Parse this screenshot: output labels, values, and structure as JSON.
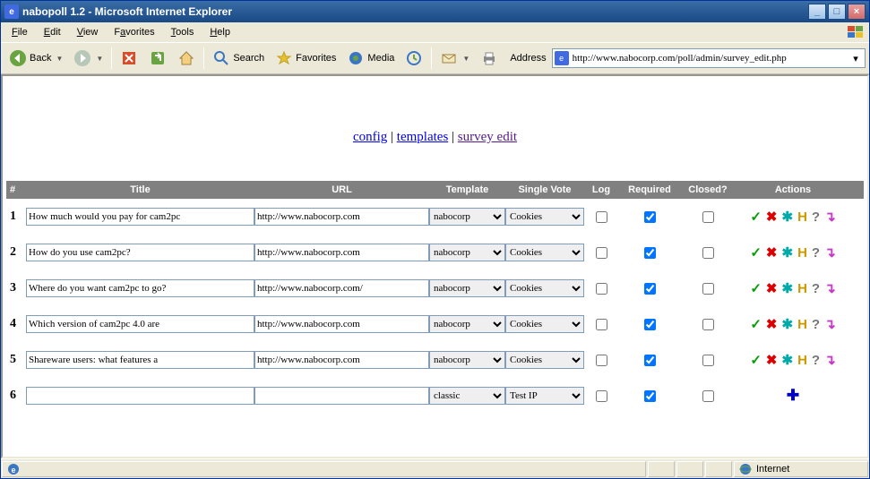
{
  "window": {
    "title": "nabopoll 1.2 - Microsoft Internet Explorer"
  },
  "menus": {
    "file": "File",
    "edit": "Edit",
    "view": "View",
    "favorites": "Favorites",
    "tools": "Tools",
    "help": "Help"
  },
  "toolbar": {
    "back": "Back",
    "search": "Search",
    "favorites": "Favorites",
    "media": "Media"
  },
  "address": {
    "label": "Address",
    "url": "http://www.nabocorp.com/poll/admin/survey_edit.php"
  },
  "nav": {
    "config": "config",
    "templates": "templates",
    "survey_edit": "survey edit",
    "sep": " | "
  },
  "headers": {
    "num": "#",
    "title": "Title",
    "url": "URL",
    "template": "Template",
    "single_vote": "Single Vote",
    "log": "Log",
    "required": "Required",
    "closed": "Closed?",
    "actions": "Actions"
  },
  "template_options": [
    "nabocorp",
    "classic"
  ],
  "sv_options": [
    "Cookies",
    "Test IP"
  ],
  "rows": [
    {
      "num": "1",
      "title": "How much would you pay for cam2pc",
      "url": "http://www.nabocorp.com",
      "template": "nabocorp",
      "sv": "Cookies",
      "log": false,
      "required": true,
      "closed": false,
      "actions_full": true
    },
    {
      "num": "2",
      "title": "How do you use cam2pc?",
      "url": "http://www.nabocorp.com",
      "template": "nabocorp",
      "sv": "Cookies",
      "log": false,
      "required": true,
      "closed": false,
      "actions_full": true
    },
    {
      "num": "3",
      "title": "Where do you want cam2pc to go?",
      "url": "http://www.nabocorp.com/",
      "template": "nabocorp",
      "sv": "Cookies",
      "log": false,
      "required": true,
      "closed": false,
      "actions_full": true
    },
    {
      "num": "4",
      "title": "Which version of cam2pc 4.0 are",
      "url": "http://www.nabocorp.com",
      "template": "nabocorp",
      "sv": "Cookies",
      "log": false,
      "required": true,
      "closed": false,
      "actions_full": true
    },
    {
      "num": "5",
      "title": "Shareware users: what features a",
      "url": "http://www.nabocorp.com",
      "template": "nabocorp",
      "sv": "Cookies",
      "log": false,
      "required": true,
      "closed": false,
      "actions_full": true
    },
    {
      "num": "6",
      "title": "",
      "url": "",
      "template": "classic",
      "sv": "Test IP",
      "log": false,
      "required": true,
      "closed": false,
      "actions_full": false
    }
  ],
  "status": {
    "zone": "Internet"
  }
}
